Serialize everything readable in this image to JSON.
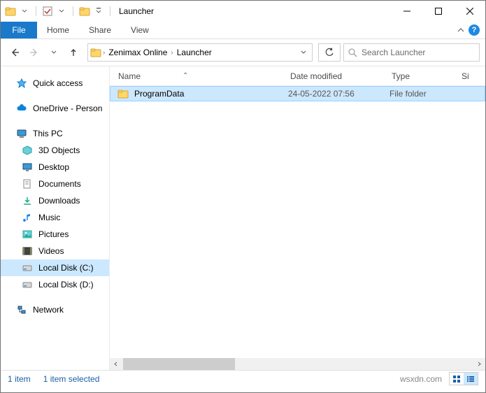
{
  "title": "Launcher",
  "ribbon": {
    "file": "File",
    "home": "Home",
    "share": "Share",
    "view": "View"
  },
  "nav": {
    "crumb1": "Zenimax Online",
    "crumb2": "Launcher"
  },
  "search": {
    "placeholder": "Search Launcher"
  },
  "columns": {
    "name": "Name",
    "date": "Date modified",
    "type": "Type",
    "size": "Si"
  },
  "files": [
    {
      "name": "ProgramData",
      "date": "24-05-2022 07:56",
      "type": "File folder"
    }
  ],
  "sidebar": {
    "quick_access": "Quick access",
    "onedrive": "OneDrive - Person",
    "this_pc": "This PC",
    "objects3d": "3D Objects",
    "desktop": "Desktop",
    "documents": "Documents",
    "downloads": "Downloads",
    "music": "Music",
    "pictures": "Pictures",
    "videos": "Videos",
    "local_c": "Local Disk (C:)",
    "local_d": "Local Disk (D:)",
    "network": "Network"
  },
  "status": {
    "count": "1 item",
    "selected": "1 item selected",
    "watermark": "wsxdn.com"
  }
}
